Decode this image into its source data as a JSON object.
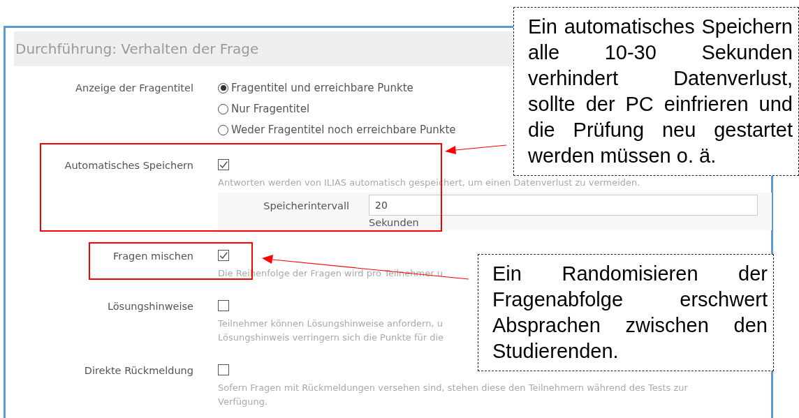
{
  "section_title": "Durchführung: Verhalten der Frage",
  "settings": [
    {
      "kind": "radio",
      "label": "Anzeige der Fragentitel",
      "options": [
        {
          "label": "Fragentitel und erreichbare Punkte",
          "selected": true
        },
        {
          "label": "Nur Fragentitel",
          "selected": false
        },
        {
          "label": "Weder Fragentitel noch erreichbare Punkte",
          "selected": false
        }
      ]
    },
    {
      "kind": "checkbox",
      "label": "Automatisches Speichern",
      "checked": true,
      "description_lines": [
        "Antworten werden von ILIAS automatisch gespeichert, um einen Datenverlust zu vermeiden."
      ],
      "subfield": {
        "label": "Speicherintervall",
        "value": "20",
        "unit": "Sekunden"
      }
    },
    {
      "kind": "checkbox",
      "label": "Fragen mischen",
      "checked": true,
      "description_lines": [
        "Die Reihenfolge der Fragen wird pro Teilnehmer u"
      ]
    },
    {
      "kind": "checkbox",
      "label": "Lösungshinweise",
      "checked": false,
      "description_lines": [
        "Teilnehmer können Lösungshinweise anfordern, u",
        "Lösungshinweis verringern sich die Punkte für die"
      ]
    },
    {
      "kind": "checkbox",
      "label": "Direkte Rückmeldung",
      "checked": false,
      "description_lines": [
        "Sofern Fragen mit Rückmeldungen versehen sind, stehen diese den Teilnehmern während des Tests zur",
        "Verfügung."
      ]
    }
  ],
  "callouts": [
    {
      "text": "Ein automatisches Speichern alle 10-30 Sekunden verhindert Datenverlust, sollte der PC einfrieren und die Prüfung neu gestartet werden müssen o. ä."
    },
    {
      "text": "Ein Randomisieren der Fragenabfolge erschwert Absprachen zwischen den Studierenden."
    }
  ]
}
